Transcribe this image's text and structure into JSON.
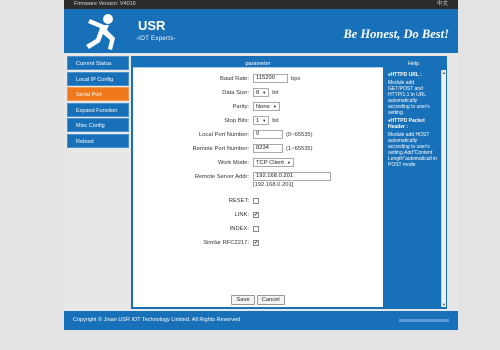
{
  "topbar": {
    "firmware": "Firmware Version: V4016",
    "lang": "中文"
  },
  "header": {
    "brand": "USR",
    "brand_sub": "-IOT Experts-",
    "slogan": "Be Honest, Do Best!",
    "logo_icon": "usr-mascot-icon"
  },
  "sidebar": {
    "items": [
      {
        "label": "Current Status",
        "active": false
      },
      {
        "label": "Local IP Config",
        "active": false
      },
      {
        "label": "Serial Port",
        "active": true
      },
      {
        "label": "Expand Function",
        "active": false
      },
      {
        "label": "Misc Config",
        "active": false
      },
      {
        "label": "Reboot",
        "active": false
      }
    ]
  },
  "panel": {
    "title": "parameter"
  },
  "form": {
    "baud_rate": {
      "label": "Baud Rate:",
      "value": "115200",
      "unit": "bps"
    },
    "data_size": {
      "label": "Data Size:",
      "value": "8",
      "unit": "bit"
    },
    "parity": {
      "label": "Parity:",
      "value": "None"
    },
    "stop_bits": {
      "label": "Stop Bits:",
      "value": "1",
      "unit": "bit"
    },
    "local_port": {
      "label": "Local Port Number:",
      "value": "0",
      "range": "(0~65535)"
    },
    "remote_port": {
      "label": "Remote Port Number:",
      "value": "8234",
      "range": "(1~65535)"
    },
    "work_mode": {
      "label": "Work Mode:",
      "value": "TCP Client"
    },
    "remote_addr": {
      "label": "Remote Server Addr:",
      "value": "192.168.0.201",
      "resolved": "[192.168.0.201]"
    },
    "reset": {
      "label": "RESET:",
      "checked": false
    },
    "link": {
      "label": "LINK:",
      "checked": true
    },
    "index": {
      "label": "INDEX:",
      "checked": false
    },
    "rfc2217": {
      "label": "Similar RFC2217:",
      "checked": true
    }
  },
  "buttons": {
    "save": "Save",
    "cancel": "Cancel"
  },
  "help": {
    "title": "Help",
    "items": [
      {
        "heading": "♦HTTPD URL :",
        "text": "Module add GET/POST and HTTP/1.1 in URL automatically according to user's setting."
      },
      {
        "heading": "♦HTTPD Packet Header :",
        "text": "Module add HOST automatically according to user's setting.Add\"Content Length\"automaticall in POST mode."
      }
    ]
  },
  "footer": {
    "copyright": "Copyright © Jinan USR IOT Technology Limited. All Rights Reserved"
  },
  "colors": {
    "primary": "#1870b8",
    "active": "#f07a1b",
    "topbar": "#2b2b2b",
    "background": "#e3e3e3"
  }
}
